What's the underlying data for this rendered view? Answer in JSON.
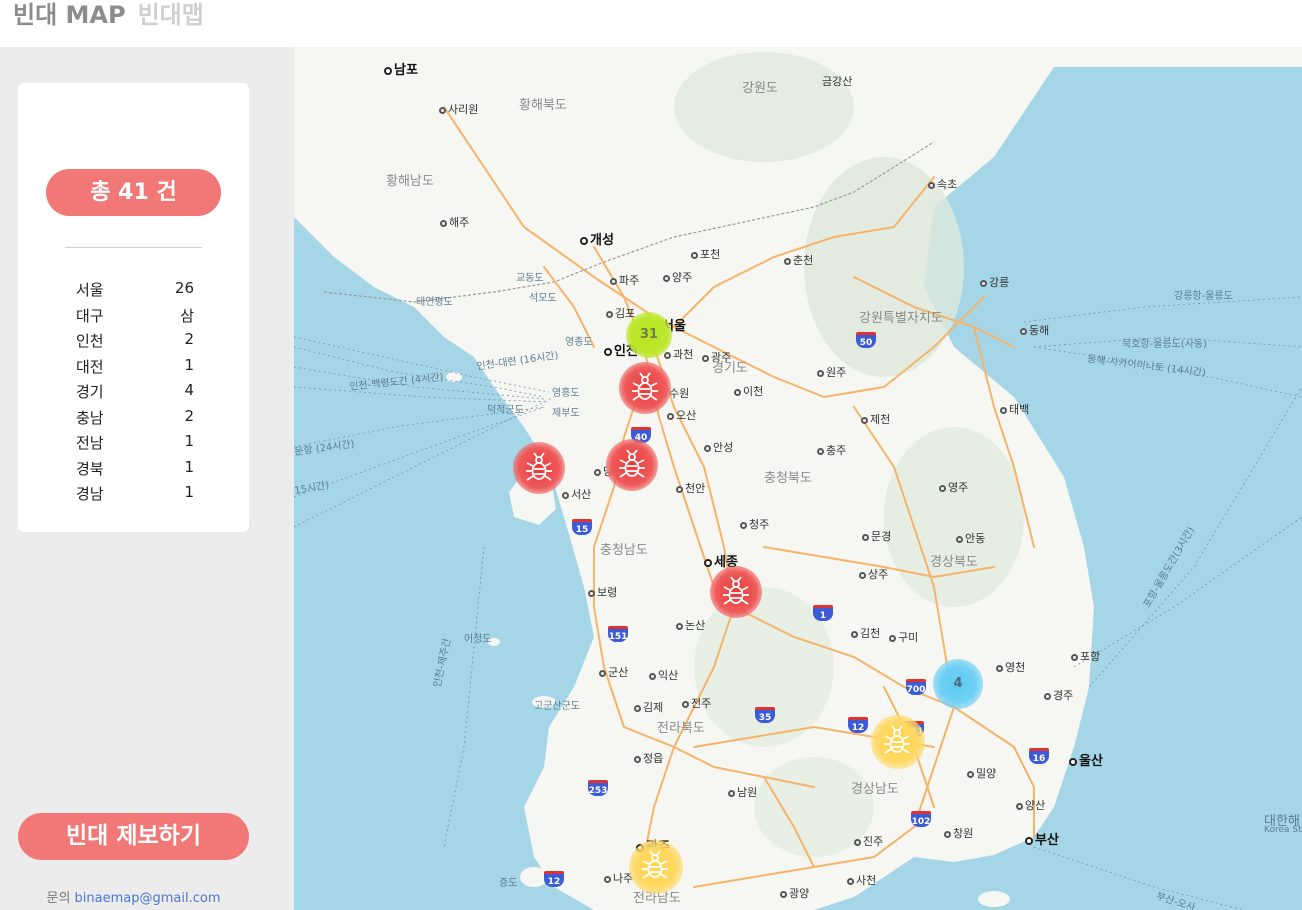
{
  "header": {
    "title_main": "빈대 MAP",
    "title_sub": "빈대맵"
  },
  "sidebar": {
    "total_label": "총 41 건",
    "stats": [
      {
        "region": "서울",
        "count": "26"
      },
      {
        "region": "대구",
        "count": "삼"
      },
      {
        "region": "인천",
        "count": "2"
      },
      {
        "region": "대전",
        "count": "1"
      },
      {
        "region": "경기",
        "count": "4"
      },
      {
        "region": "충남",
        "count": "2"
      },
      {
        "region": "전남",
        "count": "1"
      },
      {
        "region": "경북",
        "count": "1"
      },
      {
        "region": "경남",
        "count": "1"
      }
    ],
    "report_button": "빈대 제보하기",
    "contact_prefix": "문의",
    "contact_email": "binaemap@gmail.com"
  },
  "map": {
    "colors": {
      "sea": "#a4d6e8",
      "land": "#f6f6f2",
      "road": "#f4b46a",
      "accent": "#f27878"
    },
    "clusters": [
      {
        "name": "seoul-cluster",
        "count": "31",
        "color": "green"
      },
      {
        "name": "daegu-cluster",
        "count": "4",
        "color": "blue"
      }
    ],
    "markers": [
      {
        "name": "suwon-bedbug-marker",
        "icon": "bedbug-icon",
        "color": "red"
      },
      {
        "name": "seosan-bedbug-marker",
        "icon": "bedbug-icon",
        "color": "red"
      },
      {
        "name": "dangjin-bedbug-marker",
        "icon": "bedbug-icon",
        "color": "red"
      },
      {
        "name": "daejeon-bedbug-marker",
        "icon": "bedbug-icon",
        "color": "red"
      },
      {
        "name": "gyeongnam-bedbug-marker",
        "icon": "bedbug-icon",
        "color": "yellow"
      },
      {
        "name": "gwangju-bedbug-marker",
        "icon": "bedbug-icon",
        "color": "yellow"
      }
    ],
    "labels": {
      "nampo": "남포",
      "sariwon": "사리원",
      "hwanghaebukdo": "황해북도",
      "gangwondo": "강원도",
      "geumgangsan": "금강산",
      "hwanghaenamdo": "황해남도",
      "haeju": "해주",
      "sokcho": "속초",
      "gaeseong": "개성",
      "pocheon": "포천",
      "chuncheon": "춘천",
      "paju": "파주",
      "yangju": "양주",
      "gangneung": "강릉",
      "gyodongdo": "교동도",
      "seongmodo": "석모도",
      "taeyeonpyeongdo": "태연평도",
      "gangneung_ulleung": "강릉항-울릉도",
      "gimpo": "김포",
      "seoul": "서울",
      "gangwon_special": "강원특별자치도",
      "donghae": "동해",
      "yeongjongdo": "영종도",
      "incheon": "인천",
      "gwacheon": "과천",
      "gwangju_gg": "광주",
      "mukho_ulleung": "묵호항-울릉도(사동)",
      "donghae_sakaimi": "동해-사카이미나토 (14시간)",
      "incheon_daeyeon": "인천-대련 (16시간)",
      "gyeonggido": "경기도",
      "wonju": "원주",
      "incheon_baengnyeong": "인천-백령도간 (4시간)",
      "yeongheungdo": "영흥도",
      "suwon": "수원",
      "icheon": "이천",
      "deokjeokgundo": "덕적군도",
      "jebudo": "제부도",
      "osan": "오산",
      "jecheon": "제천",
      "taebaek": "태백",
      "anseong": "안성",
      "chungju": "충주",
      "route_24": "운항 (24시간)",
      "dangjin": "당진",
      "chungcheongbukdo": "충청북도",
      "route_15": "15시간)",
      "seosan": "서산",
      "cheonan": "천안",
      "yeongju": "영주",
      "cheongju": "청주",
      "pohang_ulleung": "포항-울릉도간(3시간)",
      "chungcheongnamdo": "충청남도",
      "mungyeong": "문경",
      "andong": "안동",
      "sejong": "세종",
      "gyeongsangbukdo": "경상북도",
      "sangju": "상주",
      "daejeon": "전",
      "boryeong": "보령",
      "gimcheon": "김천",
      "gumi": "구미",
      "eocheongdo": "어청도",
      "nonsan": "논산",
      "incheon_jeju": "인천-제주간",
      "pohang": "포항",
      "gunsan": "군산",
      "iksan": "익산",
      "yeongcheon": "영천",
      "daegu": "대구",
      "gyeongju": "경주",
      "gogunsangundo": "고군산군도",
      "gimje": "김제",
      "jeonju": "전주",
      "jeollabukdo": "전라북도",
      "ulsan": "울산",
      "jeongeup": "정읍",
      "miryang": "밀양",
      "gyeongsangnamdo": "경상남도",
      "yangsan": "양산",
      "namwon": "남원",
      "changwon": "창원",
      "busan": "부산",
      "jinju": "진주",
      "korea_strait": "대한해",
      "korea_strait_en": "Korea Str",
      "gwangju": "광주",
      "jeungdo": "증도",
      "naju": "나주",
      "sacheon": "사천",
      "jeollanamdo": "전라남도",
      "gwangyang": "광양",
      "busan_route": "부산-오사"
    },
    "shields": {
      "s50": "50",
      "s40": "40",
      "s15": "15",
      "s1": "1",
      "s151a": "151",
      "s700": "700",
      "s151b": "151",
      "s35": "35",
      "s12a": "12",
      "s16": "16",
      "s253": "253",
      "s102": "102",
      "s12b": "12"
    }
  }
}
